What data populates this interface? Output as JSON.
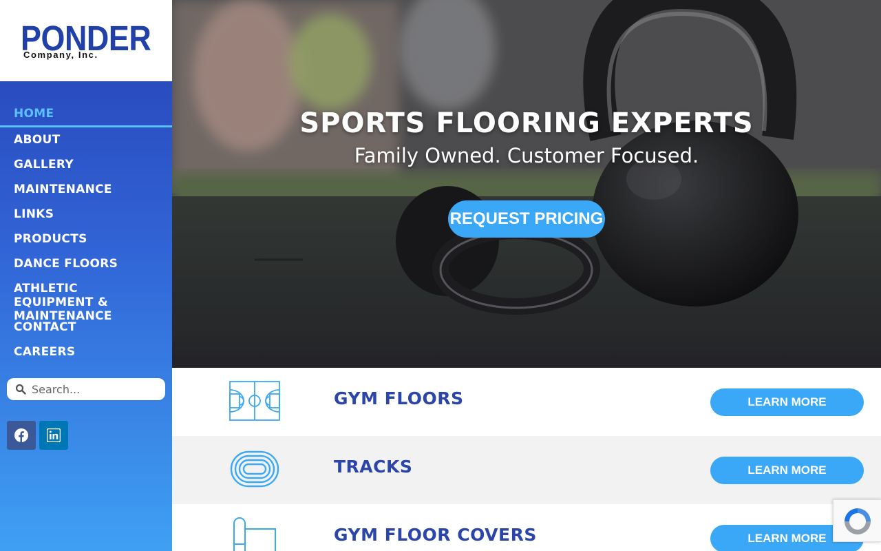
{
  "logo": {
    "main": "PONDER",
    "sub": "Company, Inc."
  },
  "nav": {
    "items": [
      {
        "label": "HOME",
        "active": true
      },
      {
        "label": "ABOUT"
      },
      {
        "label": "GALLERY"
      },
      {
        "label": "MAINTENANCE"
      },
      {
        "label": "LINKS"
      },
      {
        "label": "PRODUCTS"
      },
      {
        "label": "DANCE FLOORS"
      },
      {
        "label": "ATHLETIC EQUIPMENT & MAINTENANCE"
      },
      {
        "label": "CONTACT"
      },
      {
        "label": "CAREERS"
      }
    ]
  },
  "search": {
    "placeholder": "Search..."
  },
  "social": {
    "facebook_icon": "facebook-icon",
    "linkedin_icon": "linkedin-icon"
  },
  "hero": {
    "title": "SPORTS FLOORING EXPERTS",
    "subtitle": "Family Owned. Customer Focused.",
    "cta": "REQUEST PRICING"
  },
  "products": [
    {
      "title": "GYM FLOORS",
      "icon": "basketball-court-icon",
      "button": "LEARN MORE"
    },
    {
      "title": "TRACKS",
      "icon": "running-track-icon",
      "button": "LEARN MORE"
    },
    {
      "title": "GYM FLOOR COVERS",
      "icon": "floor-cover-roll-icon",
      "button": "LEARN MORE"
    }
  ],
  "colors": {
    "brand_blue": "#2b46a8",
    "accent_blue": "#3aa8f7",
    "active_nav": "#5cc0ff"
  }
}
